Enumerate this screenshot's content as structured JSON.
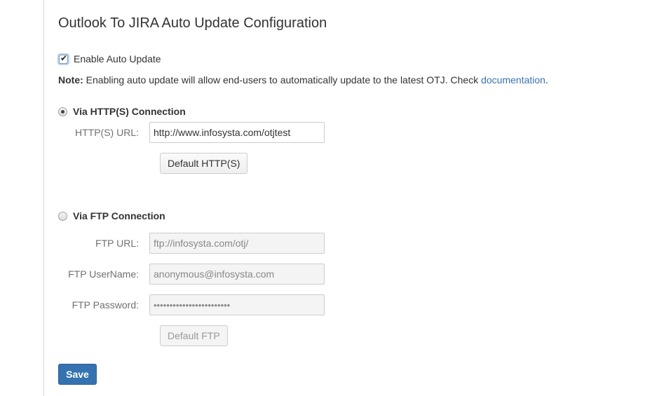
{
  "page": {
    "title": "Outlook To JIRA Auto Update Configuration"
  },
  "auto_update": {
    "label": "Enable Auto Update",
    "checked": true
  },
  "note": {
    "prefix": "Note:",
    "text": " Enabling auto update will allow end-users to automatically update to the latest OTJ. Check ",
    "link_text": "documentation",
    "suffix": "."
  },
  "http": {
    "radio_label": "Via HTTP(S) Connection",
    "selected": true,
    "url_label": "HTTP(S) URL:",
    "url_value": "http://www.infosysta.com/otjtest",
    "default_button": "Default HTTP(S)"
  },
  "ftp": {
    "radio_label": "Via FTP Connection",
    "selected": false,
    "url_label": "FTP URL:",
    "url_value": "ftp://infosysta.com/otj/",
    "username_label": "FTP UserName:",
    "username_value": "anonymous@infosysta.com",
    "password_label": "FTP Password:",
    "password_value": "••••••••••••••••••••••••",
    "default_button": "Default FTP"
  },
  "actions": {
    "save_label": "Save"
  },
  "colors": {
    "link": "#3b73af",
    "primary_button": "#3572b0",
    "divider": "#d9d9d9"
  }
}
